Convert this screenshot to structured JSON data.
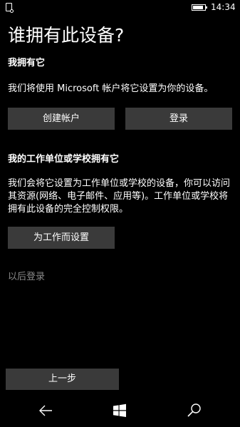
{
  "status_bar": {
    "time": "14:34",
    "battery_level": 0.85,
    "notification_icon": "device-icon"
  },
  "page": {
    "title": "谁拥有此设备?"
  },
  "personal_section": {
    "heading": "我拥有它",
    "description": "我们将使用 Microsoft 帐户将它设置为你的设备。",
    "create_account_label": "创建帐户",
    "sign_in_label": "登录"
  },
  "work_section": {
    "heading": "我的工作单位或学校拥有它",
    "description": "我们会将它设置为工作单位或学校的设备，你可以访问其资源(网络、电子邮件、应用等)。工作单位或学校将拥有此设备的完全控制权限。",
    "setup_label": "为工作而设置"
  },
  "sign_in_later_label": "以后登录",
  "back_button_label": "上一步",
  "nav_bar": {
    "back_icon": "back-arrow-icon",
    "start_icon": "windows-logo-icon",
    "search_icon": "search-icon"
  },
  "colors": {
    "background": "#000000",
    "button": "#3a3a3a",
    "text": "#ffffff",
    "muted_text": "#8a8a8a"
  }
}
